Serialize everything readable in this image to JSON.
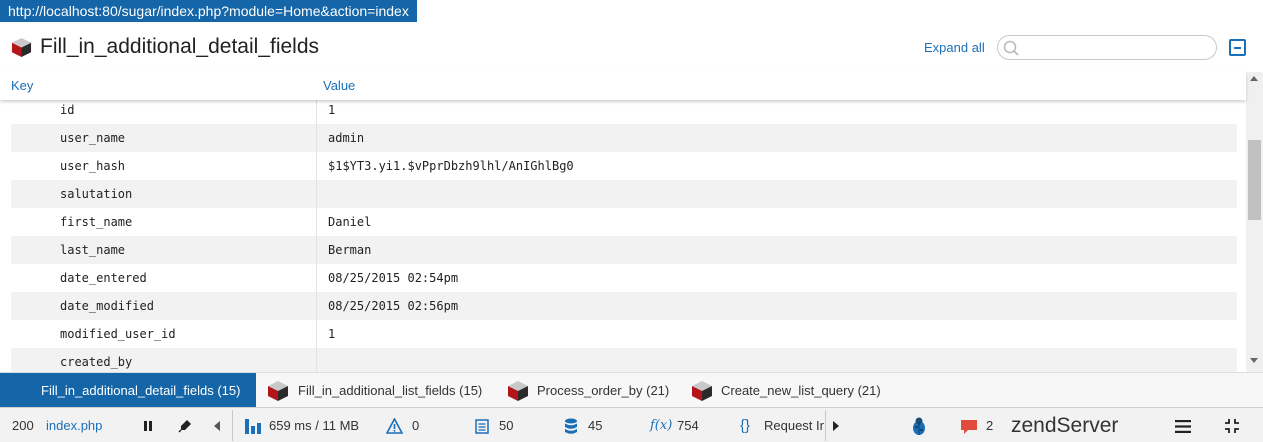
{
  "url": "http://localhost:80/sugar/index.php?module=Home&action=index",
  "panel": {
    "title": "Fill_in_additional_detail_fields",
    "expand_all": "Expand all",
    "search_placeholder": ""
  },
  "table": {
    "columns": [
      "Key",
      "Value"
    ],
    "rows": [
      {
        "key": "id",
        "value": "1"
      },
      {
        "key": "user_name",
        "value": "admin"
      },
      {
        "key": "user_hash",
        "value": "$1$YT3.yi1.$vPprDbzh9lhl/AnIGhlBg0"
      },
      {
        "key": "salutation",
        "value": ""
      },
      {
        "key": "first_name",
        "value": "Daniel"
      },
      {
        "key": "last_name",
        "value": "Berman"
      },
      {
        "key": "date_entered",
        "value": "08/25/2015 02:54pm"
      },
      {
        "key": "date_modified",
        "value": "08/25/2015 02:56pm"
      },
      {
        "key": "modified_user_id",
        "value": "1"
      },
      {
        "key": "created_by",
        "value": ""
      }
    ]
  },
  "tabs": [
    {
      "label": "Fill_in_additional_detail_fields (15)",
      "active": true
    },
    {
      "label": "Fill_in_additional_list_fields (15)",
      "active": false
    },
    {
      "label": "Process_order_by (21)",
      "active": false
    },
    {
      "label": "Create_new_list_query (21)",
      "active": false
    }
  ],
  "status_bar": {
    "status_code": "200",
    "script": "index.php",
    "time_memory": "659 ms / 11 MB",
    "warnings": "0",
    "logs": "50",
    "db_queries": "45",
    "functions": "754",
    "request_label": "Request In",
    "notifications": "2",
    "brand_zend": "zend",
    "brand_server": "Server"
  },
  "colors": {
    "accent": "#1566a8",
    "link": "#1a70b8",
    "alt_row": "#f2f2f2",
    "notification": "#e14b3b"
  },
  "icons": {
    "panel": "cube-icon",
    "search": "search-icon",
    "collapse": "collapse-icon",
    "pause": "pause-icon",
    "pin": "pin-icon",
    "time": "bar-chart-icon",
    "warnings": "warning-icon",
    "logs": "log-icon",
    "db": "database-icon",
    "functions": "function-icon",
    "request": "braces-icon",
    "bug": "bug-icon",
    "notifications": "chat-icon",
    "menu": "hamburger-icon",
    "minimize": "shrink-icon"
  }
}
